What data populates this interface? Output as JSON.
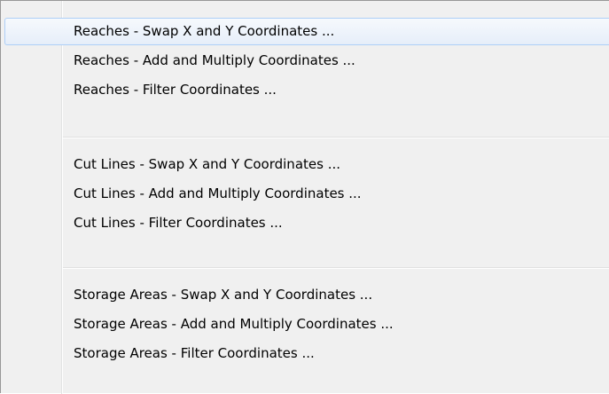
{
  "menu": {
    "groups": [
      {
        "items": [
          {
            "label": "Reaches - Swap X and Y Coordinates ..."
          },
          {
            "label": "Reaches - Add and Multiply Coordinates ..."
          },
          {
            "label": "Reaches - Filter Coordinates ..."
          }
        ]
      },
      {
        "items": [
          {
            "label": "Cut Lines - Swap X and Y Coordinates ..."
          },
          {
            "label": "Cut Lines - Add and Multiply Coordinates ..."
          },
          {
            "label": "Cut Lines - Filter Coordinates ..."
          }
        ]
      },
      {
        "items": [
          {
            "label": "Storage Areas - Swap X and Y Coordinates ..."
          },
          {
            "label": "Storage Areas - Add and Multiply Coordinates ..."
          },
          {
            "label": "Storage Areas - Filter Coordinates ..."
          }
        ]
      }
    ],
    "highlighted_item": "Reaches - Swap X and Y Coordinates ..."
  }
}
